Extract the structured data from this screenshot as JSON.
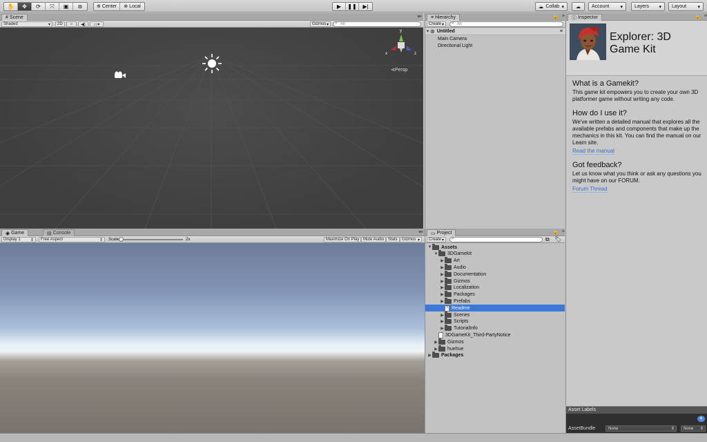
{
  "toolbar": {
    "tools": [
      "hand-tool",
      "move-tool",
      "rotate-tool",
      "scale-tool",
      "rect-tool",
      "transform-tool"
    ],
    "pivot_label": "Center",
    "space_label": "Local",
    "collab_label": "Collab",
    "account_label": "Account",
    "layers_label": "Layers",
    "layout_label": "Layout"
  },
  "scene": {
    "tab": "Scene",
    "shading": "Shaded",
    "mode_2d": "2D",
    "gizmos": "Gizmos",
    "search_placeholder": "All",
    "persp": "Persp",
    "axis_y": "y",
    "axis_x": "x",
    "axis_z": "z"
  },
  "game": {
    "tab": "Game",
    "console_tab": "Console",
    "display": "Display 1",
    "aspect": "Free Aspect",
    "scale_label": "Scale",
    "scale_value": "2x",
    "maximize": "Maximize On Play",
    "mute": "Mute Audio",
    "stats": "Stats",
    "gizmos": "Gizmos"
  },
  "hierarchy": {
    "tab": "Hierarchy",
    "create": "Create",
    "search_placeholder": "All",
    "scene_name": "Untitled",
    "items": [
      "Main Camera",
      "Directional Light"
    ]
  },
  "project": {
    "tab": "Project",
    "create": "Create",
    "rows": [
      {
        "label": "Assets",
        "depth": 0,
        "type": "folder",
        "expanded": true,
        "bold": true
      },
      {
        "label": "3DGamekit",
        "depth": 1,
        "type": "folder",
        "expanded": true
      },
      {
        "label": "Art",
        "depth": 2,
        "type": "folder"
      },
      {
        "label": "Audio",
        "depth": 2,
        "type": "folder"
      },
      {
        "label": "Documentation",
        "depth": 2,
        "type": "folder"
      },
      {
        "label": "Gizmos",
        "depth": 2,
        "type": "folder"
      },
      {
        "label": "Localization",
        "depth": 2,
        "type": "folder"
      },
      {
        "label": "Packages",
        "depth": 2,
        "type": "folder"
      },
      {
        "label": "Prefabs",
        "depth": 2,
        "type": "folder"
      },
      {
        "label": "Readme",
        "depth": 2,
        "type": "file",
        "selected": true
      },
      {
        "label": "Scenes",
        "depth": 2,
        "type": "folder"
      },
      {
        "label": "Scripts",
        "depth": 2,
        "type": "folder"
      },
      {
        "label": "TutorialInfo",
        "depth": 2,
        "type": "folder"
      },
      {
        "label": "3DGameKit_Third-PartyNotice",
        "depth": 1,
        "type": "file"
      },
      {
        "label": "Gizmos",
        "depth": 1,
        "type": "folder"
      },
      {
        "label": "huehue",
        "depth": 1,
        "type": "folder"
      },
      {
        "label": "Packages",
        "depth": 0,
        "type": "folder",
        "bold": true
      }
    ]
  },
  "inspector": {
    "tab": "Inspector",
    "title_line1": "Explorer: 3D",
    "title_line2": "Game Kit",
    "sections": [
      {
        "heading": "What is a Gamekit?",
        "body": "This game kit empowers you to create your own 3D platformer game without writing any code.",
        "link": ""
      },
      {
        "heading": "How do I use it?",
        "body": "We've written a detailed manual that explores all the available prefabs and components that make up the mechanics in this kit. You can find the manual on our Learn site.",
        "link": "Read the manual"
      },
      {
        "heading": "Got feedback?",
        "body": "Let us know what you think or ask any questions you might have on our FORUM.",
        "link": "Forum Thread"
      }
    ],
    "asset_labels": "Asset Labels",
    "asset_bundle": "AssetBundle",
    "bundle_value": "None",
    "variant_value": "None"
  },
  "colors": {
    "selection": "#3c78d8",
    "link": "#3a6fc6",
    "scene_bg": "#474747"
  }
}
